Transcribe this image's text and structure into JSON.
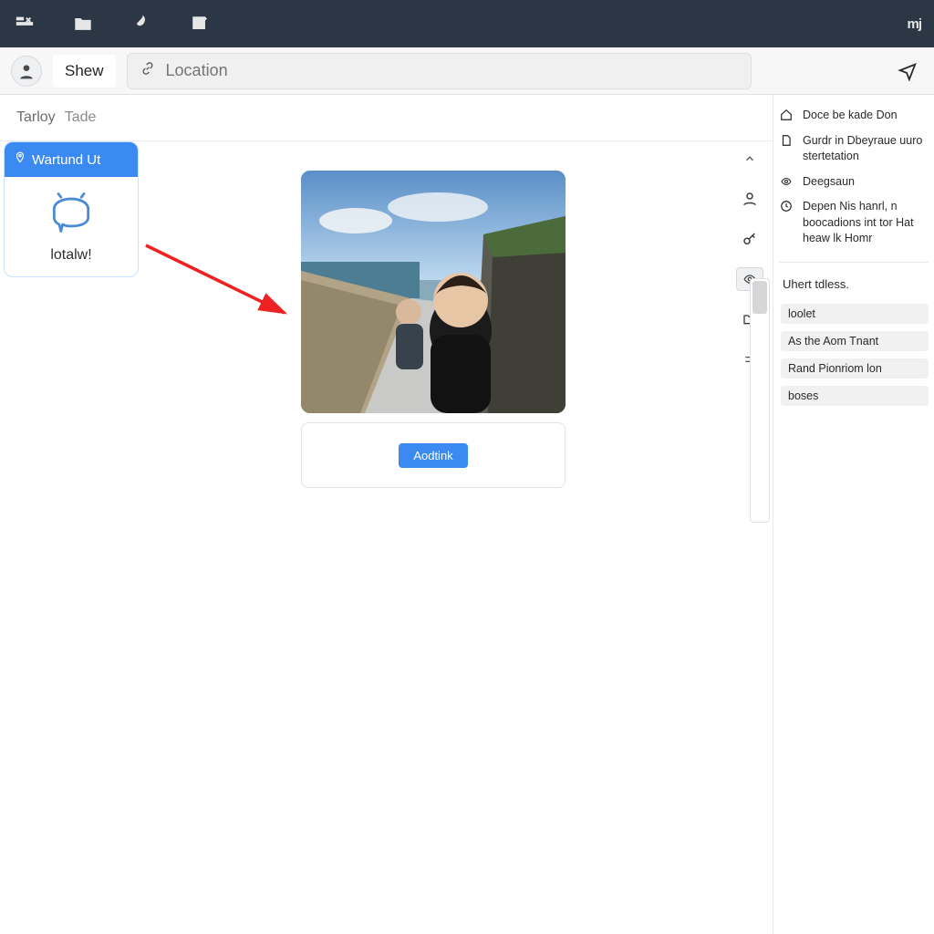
{
  "titlebar": {
    "brand": "mj"
  },
  "toolbar": {
    "show_label": "Shew",
    "location_placeholder": "Location",
    "location_value": ""
  },
  "tabs": {
    "primary": "Tarloy",
    "secondary": "Tade"
  },
  "card": {
    "title": "Wartund Ut",
    "caption": "lotalw!"
  },
  "photo_action": {
    "label": "Aodtink"
  },
  "sidepanel": {
    "items": [
      {
        "text": "Doce be kade Don"
      },
      {
        "text": "Gurdr in Dbeyraue uuro stertetation"
      },
      {
        "text": "Deegsaun"
      },
      {
        "text": "Depen Nis hanrl, n boocadions int tor Hat heaw lk Homr"
      }
    ],
    "section2_title": "Uhert tdless.",
    "chips": [
      "loolet",
      "As the Aom Tnant",
      "Rand Pionriom lon",
      "boses"
    ]
  }
}
